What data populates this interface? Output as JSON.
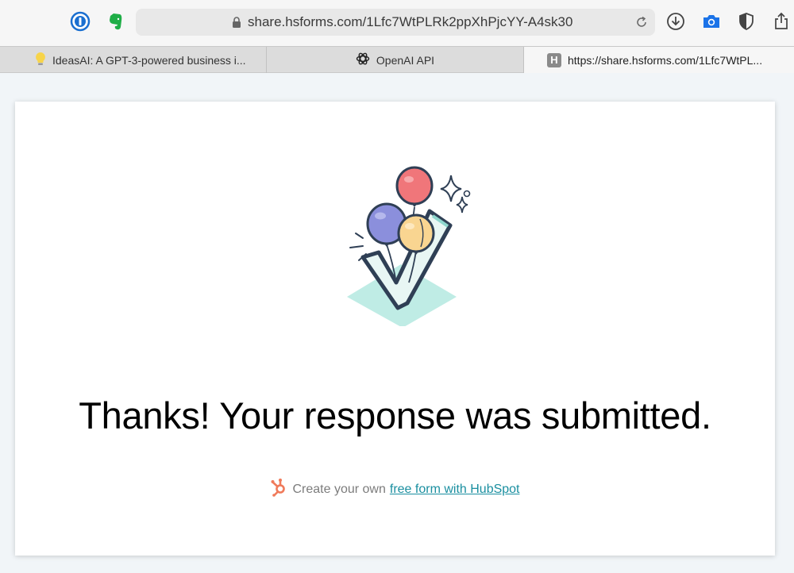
{
  "browser": {
    "address_url": "share.hsforms.com/1Lfc7WtPLRk2ppXhPjcYY-A4sk30",
    "toolbar_icons": [
      "1password-icon",
      "evernote-icon",
      "download-icon",
      "camera-icon",
      "shield-icon",
      "share-icon"
    ],
    "tabs": [
      {
        "title": "IdeasAI: A GPT-3-powered business i...",
        "icon": "lightbulb-icon"
      },
      {
        "title": "OpenAI API",
        "icon": "openai-icon"
      },
      {
        "title": "https://share.hsforms.com/1Lfc7WtPL...",
        "icon": "h-favicon",
        "favicon_letter": "H",
        "active": true
      }
    ]
  },
  "page": {
    "heading": "Thanks! Your response was submitted.",
    "footer_text": "Create your own",
    "footer_link": "free form with HubSpot"
  },
  "colors": {
    "link": "#1a8fa0",
    "hubspot_orange": "#f07a5a",
    "balloon_red": "#f0767a",
    "balloon_purple": "#8b8fdc",
    "balloon_yellow": "#f9d591",
    "check_fill": "#e8f6f4",
    "base_mint": "#bfece5"
  }
}
